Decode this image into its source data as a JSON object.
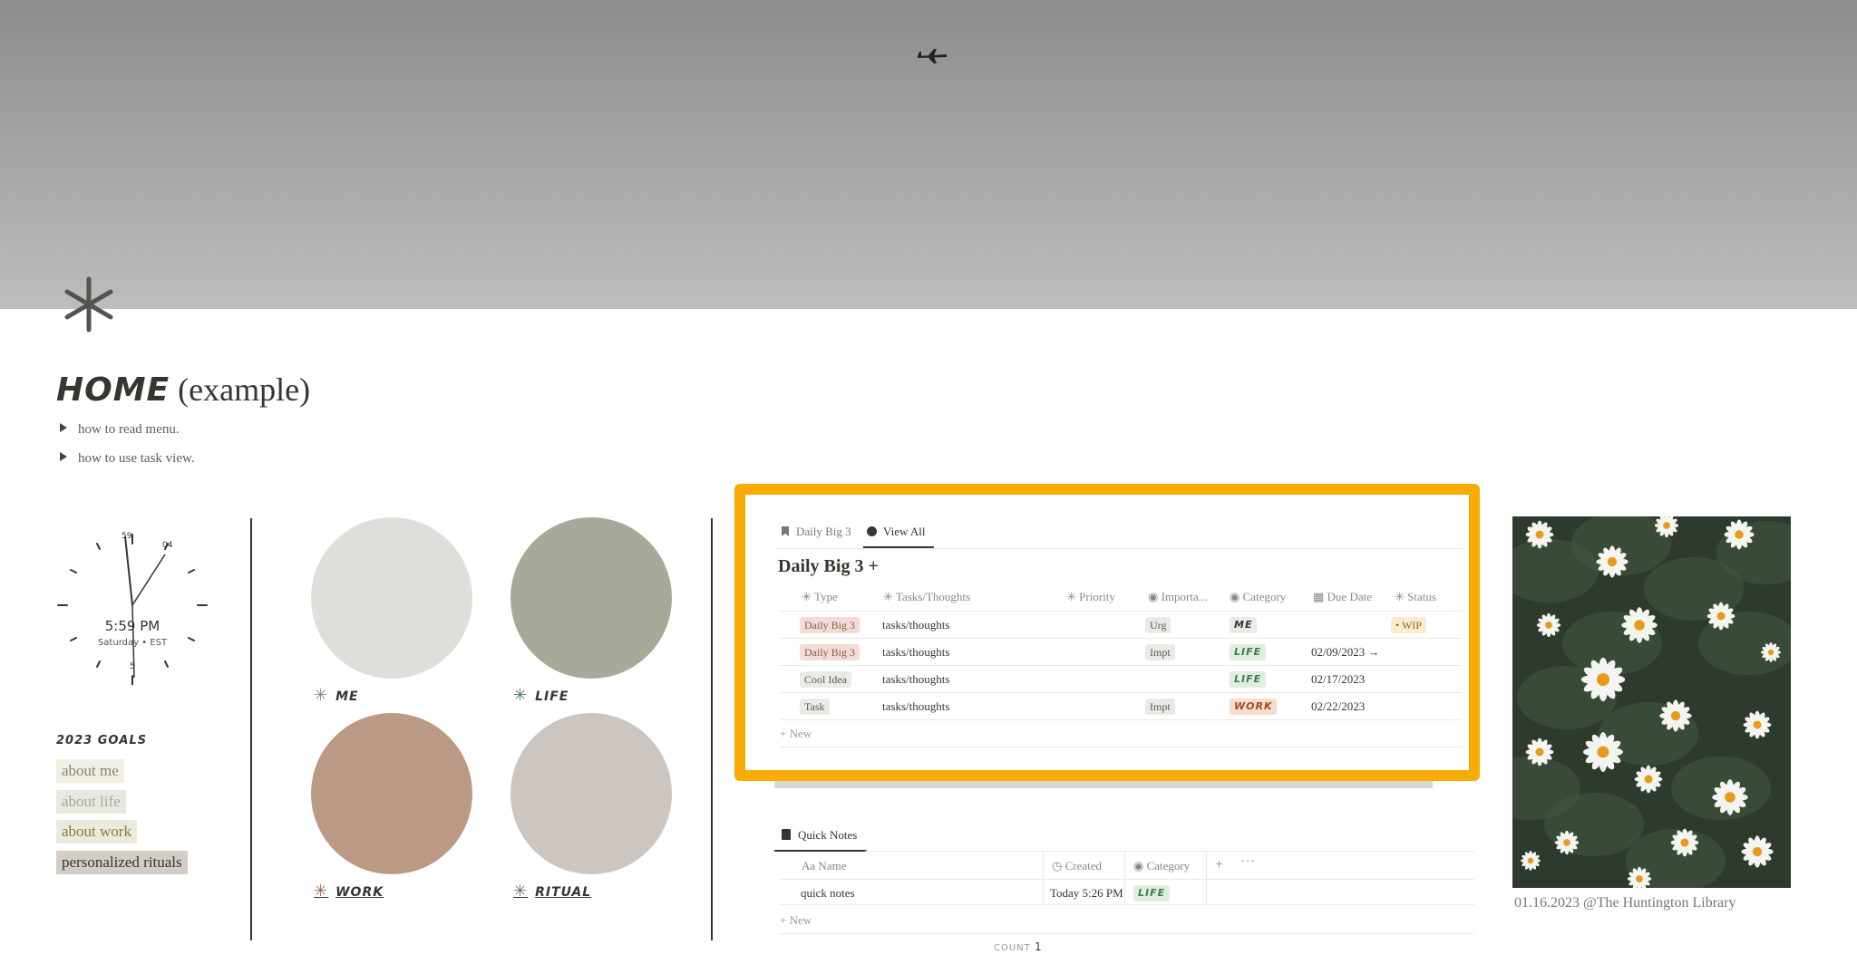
{
  "page": {
    "title_bold": "HOME",
    "title_rest": " (example)",
    "toggles": [
      "how to read menu.",
      "how to use task view."
    ]
  },
  "clock": {
    "time": "5:59 PM",
    "sub": "Saturday • EST",
    "hour_marks": [
      "59",
      "04",
      "5"
    ]
  },
  "goals": {
    "heading": "2023 GOALS",
    "items": [
      {
        "label": "about me",
        "bg": "#f1eee4",
        "color": "#8b8672"
      },
      {
        "label": "about life",
        "bg": "#e9e8e0",
        "color": "#a9a89c"
      },
      {
        "label": "about work",
        "bg": "#eeeadb",
        "color": "#857a52"
      },
      {
        "label": "personalized rituals",
        "bg": "#d4ccc6",
        "color": "#37352f"
      }
    ]
  },
  "areas": [
    {
      "label": "ME",
      "color": "#e0deda",
      "accent": "#8a8883"
    },
    {
      "label": "LIFE",
      "color": "#a6aa99",
      "accent": "#4d7a68"
    },
    {
      "label": "WORK",
      "color": "#bb9a85",
      "accent": "#a26b55"
    },
    {
      "label": "RITUAL",
      "color": "#cdc6c0",
      "accent": "#6f6e69"
    }
  ],
  "tasks_db": {
    "tabs": [
      "Daily Big 3",
      "View All"
    ],
    "title": "Daily Big 3 +",
    "columns": [
      "Type",
      "Tasks/Thoughts",
      "Priority",
      "Importa...",
      "Category",
      "Due Date",
      "Status"
    ],
    "rows": [
      {
        "type": "Daily Big 3",
        "task": "tasks/thoughts",
        "importance": "Urg",
        "category": "ME",
        "due": "",
        "status": "• WIP"
      },
      {
        "type": "Daily Big 3",
        "task": "tasks/thoughts",
        "importance": "Impt",
        "category": "LIFE",
        "due": "02/09/2023 →",
        "status": ""
      },
      {
        "type": "Cool Idea",
        "task": "tasks/thoughts",
        "importance": "",
        "category": "LIFE",
        "due": "02/17/2023",
        "status": ""
      },
      {
        "type": "Task",
        "task": "tasks/thoughts",
        "importance": "Impt",
        "category": "WORK",
        "due": "02/22/2023",
        "status": ""
      }
    ],
    "new_label": "New",
    "highlight_color": "#f8ab00"
  },
  "notes_db": {
    "tab": "Quick Notes",
    "columns": [
      "Name",
      "Created",
      "Category"
    ],
    "name_prefix": "Aa",
    "rows": [
      {
        "name": "quick notes",
        "created": "Today 5:26 PM",
        "category": "LIFE"
      }
    ],
    "new_label": "New",
    "count_label": "COUNT",
    "count_value": "1"
  },
  "photo": {
    "caption": "01.16.2023 @The Huntington Library"
  }
}
